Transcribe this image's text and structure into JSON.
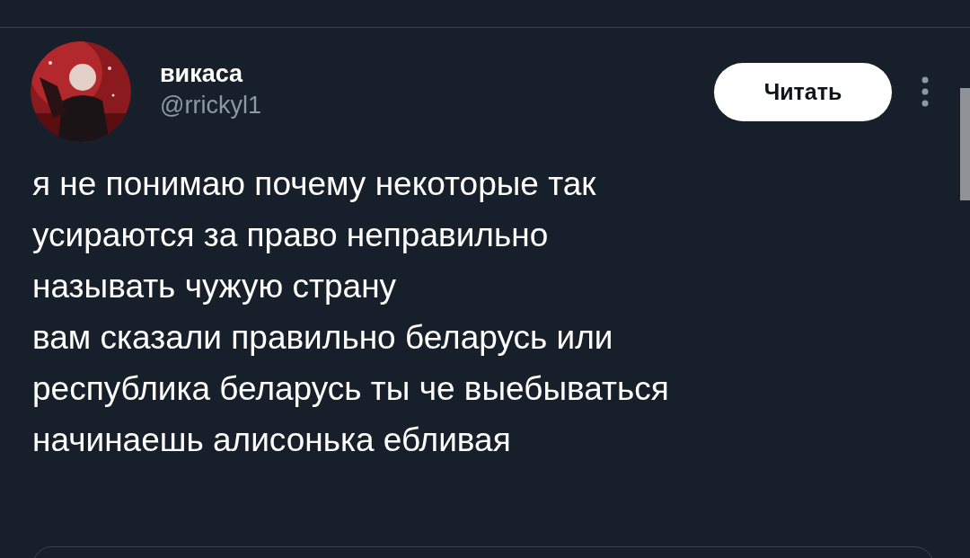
{
  "author": {
    "name": "викаса",
    "handle": "@rrickyl1"
  },
  "follow_button": {
    "label": "Читать"
  },
  "tweet": {
    "text": "я не понимаю почему некоторые так\nусираются за право неправильно\nназывать чужую страну\nвам сказали правильно беларусь или\nреспублика беларусь ты че выебываться\nначинаешь алисонька ебливая"
  }
}
